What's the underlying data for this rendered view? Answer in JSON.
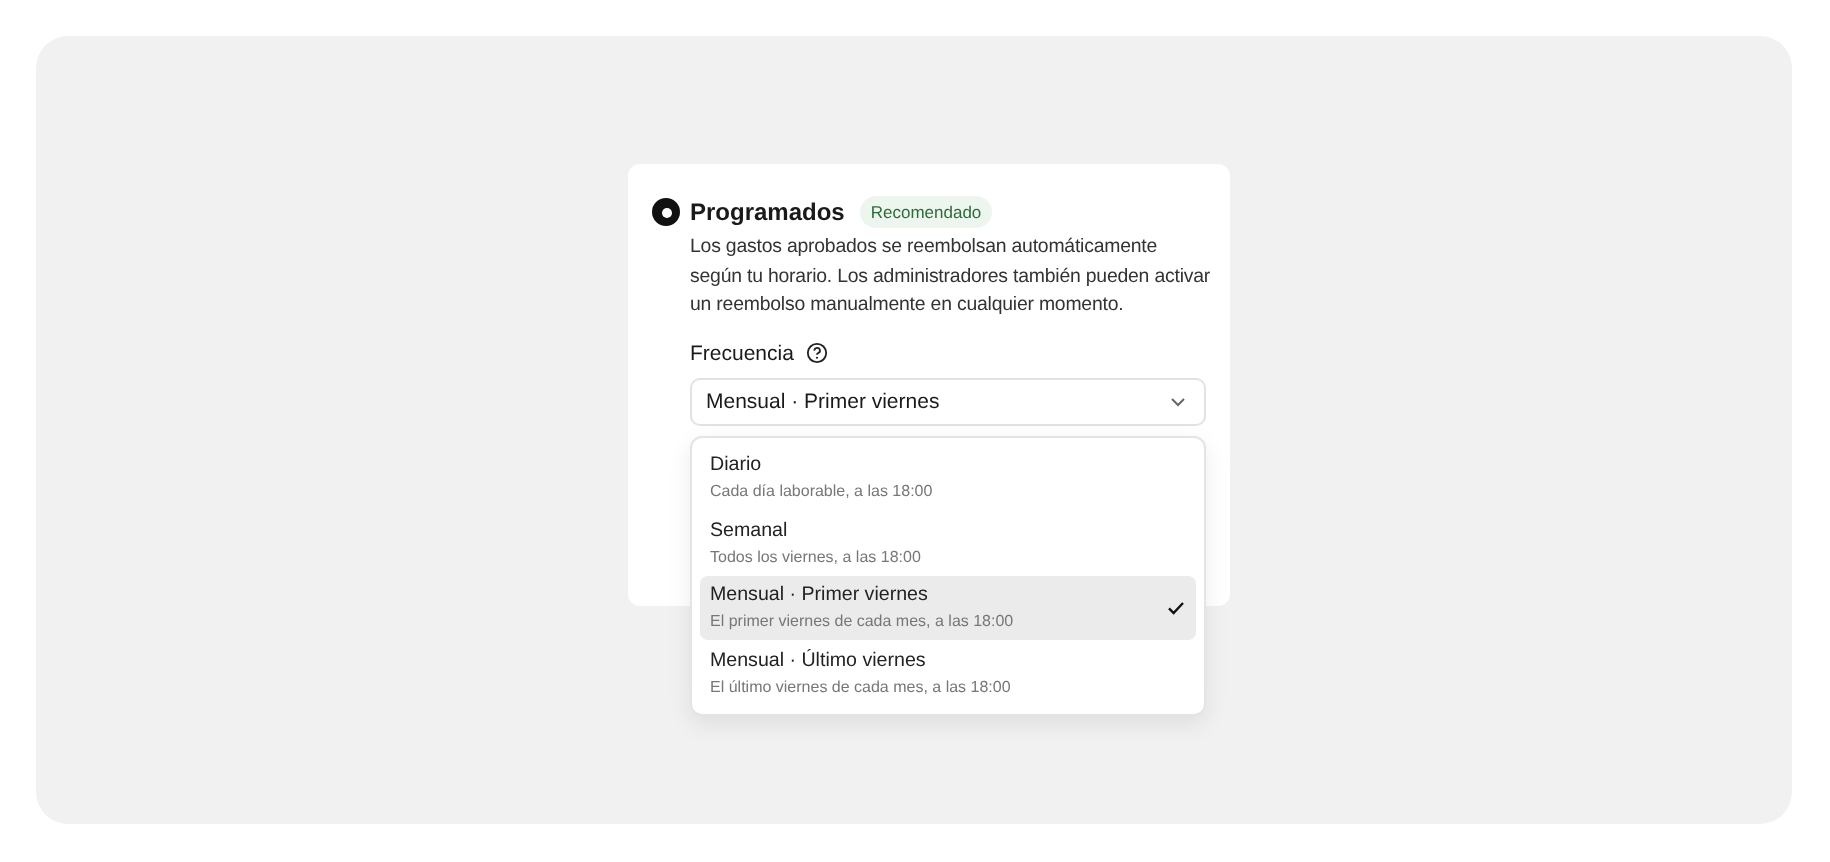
{
  "option": {
    "title": "Programados",
    "selected": true,
    "badge": "Recomendado",
    "description": "Los gastos aprobados se reembolsan automáticamente según tu horario. Los administradores también pueden activar un reembolso manualmente en cualquier momento."
  },
  "frequency": {
    "label": "Frecuencia",
    "value": "Mensual · Primer viernes",
    "expanded": true,
    "options": [
      {
        "label": "Diario",
        "detail": "Cada día laborable, a las 18:00",
        "selected": false
      },
      {
        "label": "Semanal",
        "detail": "Todos los viernes, a las 18:00",
        "selected": false
      },
      {
        "label": "Mensual · Primer viernes",
        "detail": "El primer viernes de cada mes, a las 18:00",
        "selected": true
      },
      {
        "label": "Mensual · Último viernes",
        "detail": "El último viernes de cada mes, a las 18:00",
        "selected": false
      }
    ]
  }
}
